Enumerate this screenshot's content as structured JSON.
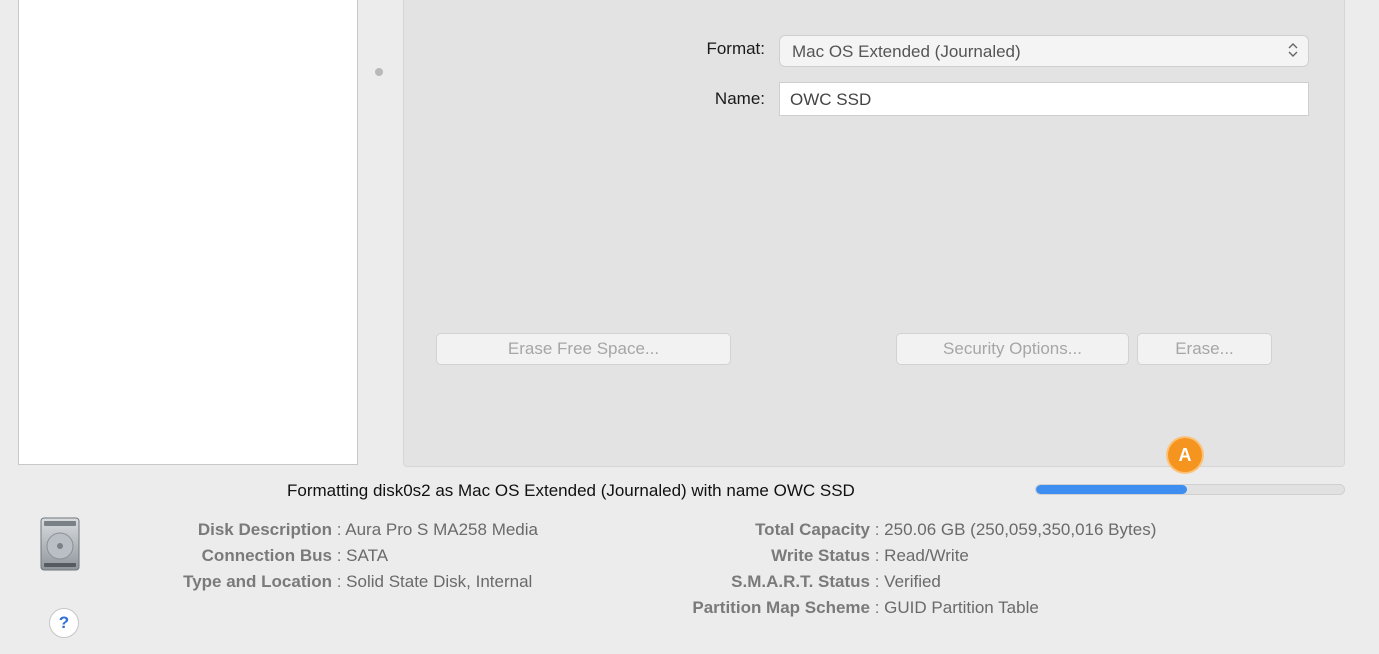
{
  "form": {
    "format_label": "Format:",
    "format_value": "Mac OS Extended (Journaled)",
    "name_label": "Name:",
    "name_value": "OWC SSD"
  },
  "buttons": {
    "erase_free_space": "Erase Free Space...",
    "security_options": "Security Options...",
    "erase": "Erase..."
  },
  "annotation": {
    "label": "A"
  },
  "progress": {
    "text": "Formatting disk0s2 as Mac OS Extended (Journaled) with name OWC SSD",
    "fraction": 0.49
  },
  "disk_info": {
    "left": [
      {
        "key": "Disk Description",
        "value": "Aura Pro S MA258 Media"
      },
      {
        "key": "Connection Bus",
        "value": "SATA"
      },
      {
        "key": "Type and Location",
        "value": "Solid State Disk, Internal"
      }
    ],
    "right": [
      {
        "key": "Total Capacity",
        "value": "250.06 GB (250,059,350,016 Bytes)"
      },
      {
        "key": "Write Status",
        "value": "Read/Write"
      },
      {
        "key": "S.M.A.R.T. Status",
        "value": "Verified"
      },
      {
        "key": "Partition Map Scheme",
        "value": "GUID Partition Table"
      }
    ]
  },
  "help": {
    "label": "?"
  },
  "icons": {
    "disk": "hard-disk-icon",
    "format_arrows": "up-down-chevron-icon"
  },
  "colors": {
    "progress_fill": "#3d8ef0",
    "annotation_badge": "#f5941f"
  }
}
